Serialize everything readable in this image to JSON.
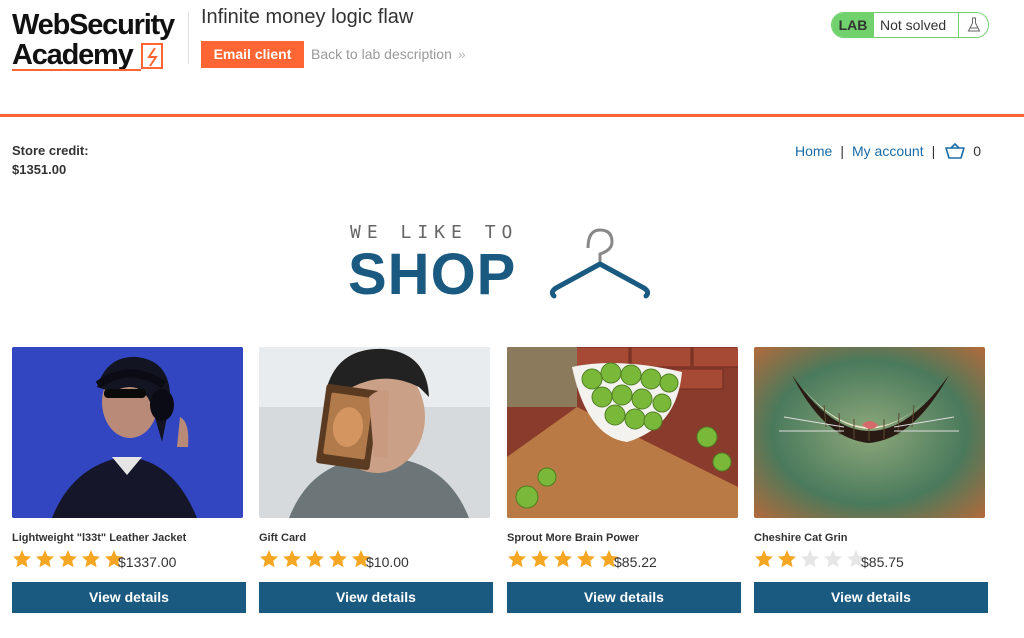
{
  "header": {
    "logo_line1": "WebSecurity",
    "logo_line2": "Academy",
    "lab_title": "Infinite money logic flaw",
    "email_client_label": "Email client",
    "back_link_label": "Back to lab description",
    "back_link_chevron": "»",
    "lab_tag": "LAB",
    "lab_status": "Not solved",
    "colors": {
      "accent": "#ff6633",
      "lab_green": "#70d16d"
    }
  },
  "account": {
    "credit_label": "Store credit:",
    "credit_value": "$1351.00",
    "nav": {
      "home": "Home",
      "my_account": "My account",
      "separator": "|",
      "cart_count": "0"
    }
  },
  "banner": {
    "top_text": "WE LIKE TO",
    "main_text": "SHOP",
    "color": "#1a5a80"
  },
  "products": [
    {
      "name": "Lightweight \"l33t\" Leather Jacket",
      "price": "$1337.00",
      "rating": 5,
      "button": "View details"
    },
    {
      "name": "Gift Card",
      "price": "$10.00",
      "rating": 5,
      "button": "View details"
    },
    {
      "name": "Sprout More Brain Power",
      "price": "$85.22",
      "rating": 5,
      "button": "View details"
    },
    {
      "name": "Cheshire Cat Grin",
      "price": "$85.75",
      "rating": 2,
      "button": "View details"
    }
  ]
}
